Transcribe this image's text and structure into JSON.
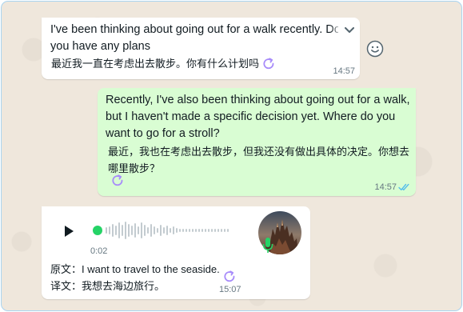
{
  "messages": [
    {
      "direction": "incoming",
      "text_lines": [
        "I've been thinking about going out for a walk recently. Do",
        "you have any plans"
      ],
      "translation": "最近我一直在考虑出去散步。你有什么计划吗",
      "time": "14:57"
    },
    {
      "direction": "outgoing",
      "text": "Recently, I've also been thinking about going out for a walk, but I haven't made a specific decision yet. Where do you want to go for a stroll?",
      "translation": "最近，我也在考虑出去散步，但我还没有做出具体的决定。你想去哪里散步？",
      "time": "14:57",
      "status_icon": "double-check-icon"
    },
    {
      "direction": "incoming",
      "type": "voice",
      "duration": "0:02",
      "original_label": "原文：I want to travel to the seaside.",
      "translation_label": "译文：我想去海边旅行。",
      "time": "15:07"
    }
  ],
  "colors": {
    "incoming_bubble": "#ffffff",
    "outgoing_bubble": "#d9fdd3",
    "chat_background": "#efe7dc",
    "accent_purple": "#a78bfa",
    "read_ticks": "#53bdeb",
    "voice_dot": "#25d366"
  },
  "icons": [
    "chevron-down-icon",
    "emoji-icon",
    "refresh-icon",
    "play-icon",
    "microphone-icon",
    "double-check-icon"
  ]
}
